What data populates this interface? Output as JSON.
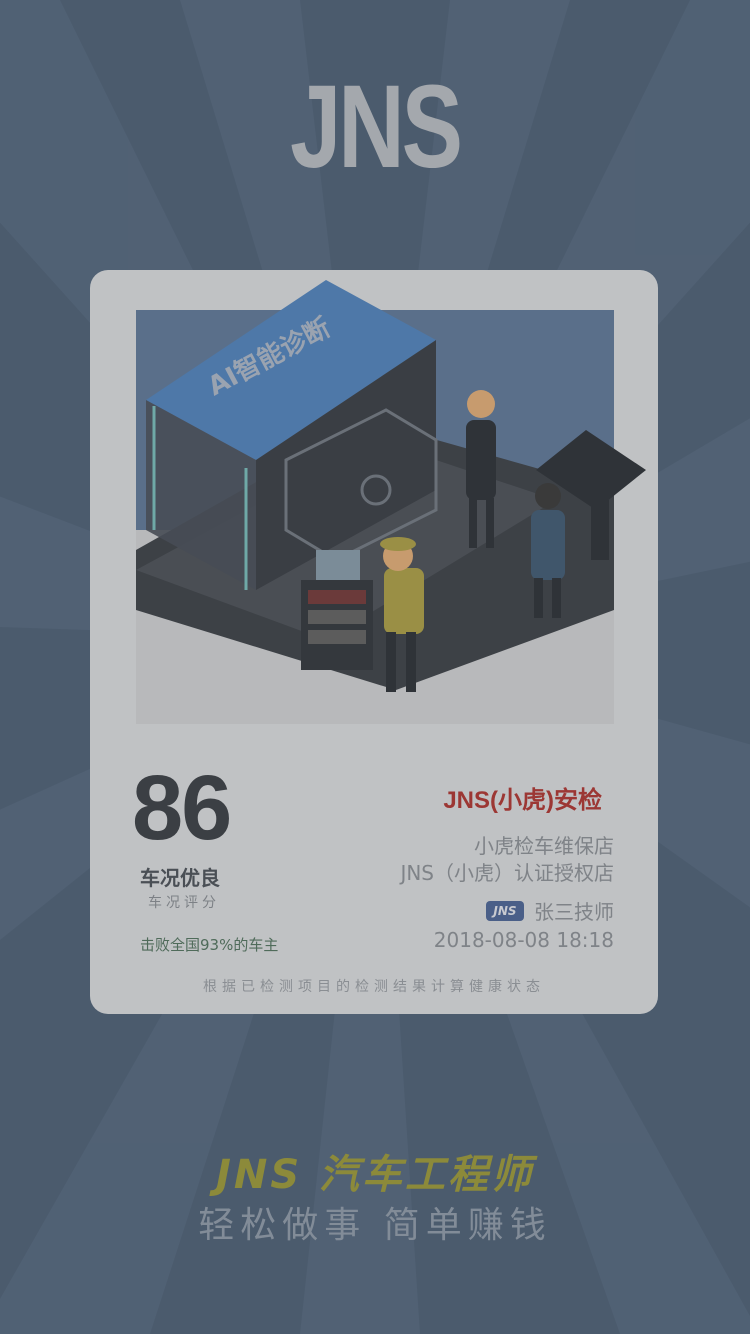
{
  "header": {
    "logo_text": "JNS"
  },
  "card": {
    "illustration": {
      "booth_sign": "AI智能诊断",
      "icons": [
        "inspection-booth",
        "car",
        "technician",
        "customer",
        "staff",
        "tool-cart",
        "kiosk"
      ]
    },
    "score": "86",
    "score_label": "车况优良",
    "score_sub": "车况评分",
    "beat_text": "击败全国93%的车主",
    "brand": "JNS(小虎)安检",
    "shop_name": "小虎检车维保店",
    "shop_cert": "JNS（小虎）认证授权店",
    "tech_badge": "JNS",
    "technician": "张三技师",
    "date": "2018-08-08 18:18",
    "footnote": "根据已检测项目的检测结果计算健康状态"
  },
  "footer": {
    "slogan_brand": "JNS 汽车工程师",
    "slogan_tagline": "轻松做事 简单赚钱"
  },
  "colors": {
    "background": "#49596b",
    "card": "#c0c2c4",
    "brand_red": "#9c3734",
    "slogan_gold": "#8c8a3a"
  }
}
